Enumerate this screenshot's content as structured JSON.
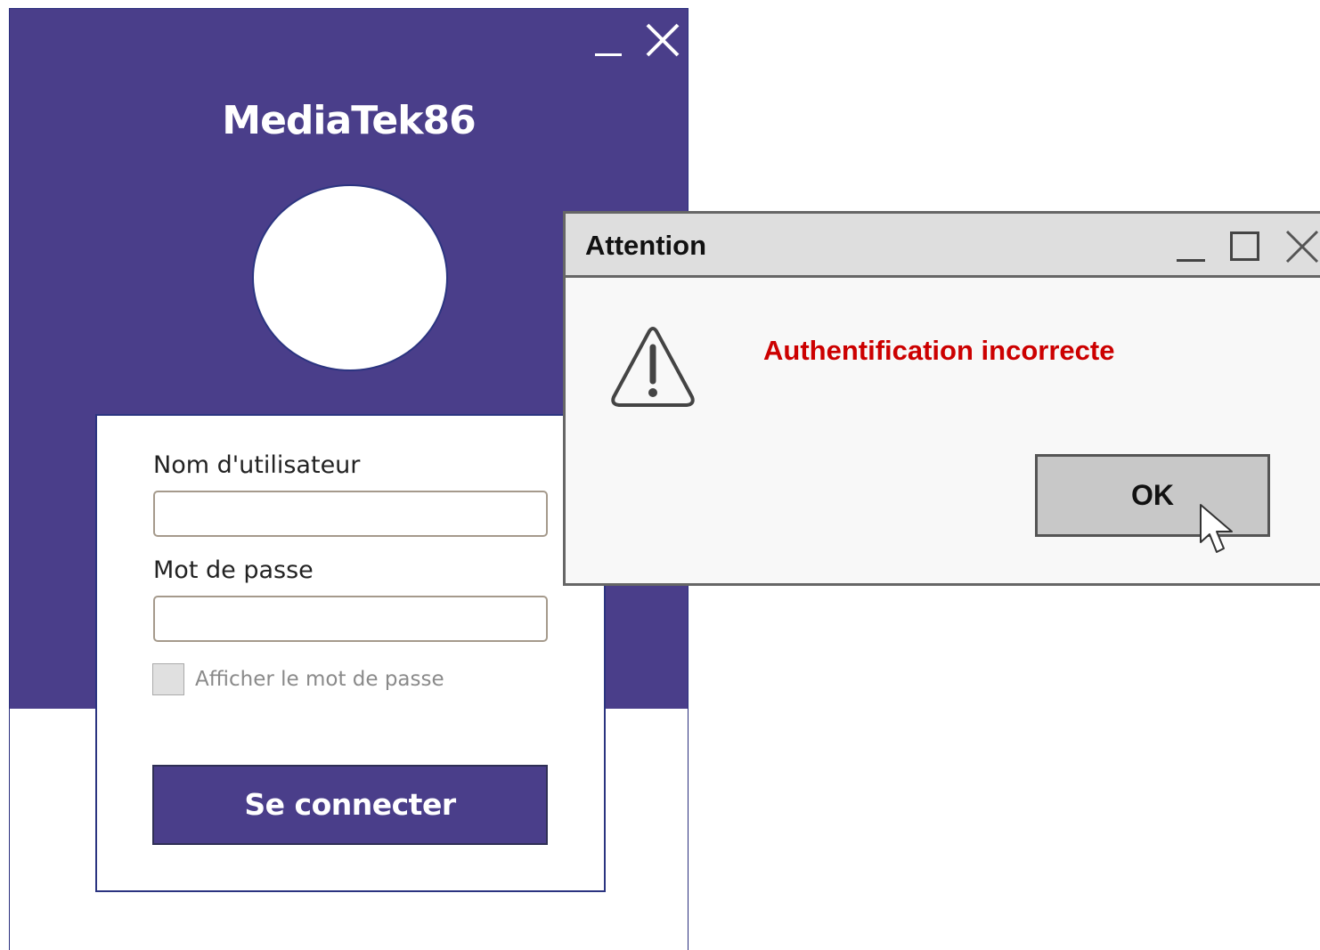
{
  "login": {
    "app_title": "MediaTek86",
    "username_label": "Nom d'utilisateur",
    "username_value": "",
    "password_label": "Mot de passe",
    "password_value": "",
    "show_password_label": "Afficher le mot de passe",
    "connect_button": "Se connecter",
    "colors": {
      "primary": "#4a3e8a",
      "border": "#2b3480"
    }
  },
  "dialog": {
    "title": "Attention",
    "message": "Authentification incorrecte",
    "ok_button": "OK",
    "icon": "warning-icon",
    "colors": {
      "message": "#cc0000",
      "titlebar": "#dedede"
    }
  }
}
